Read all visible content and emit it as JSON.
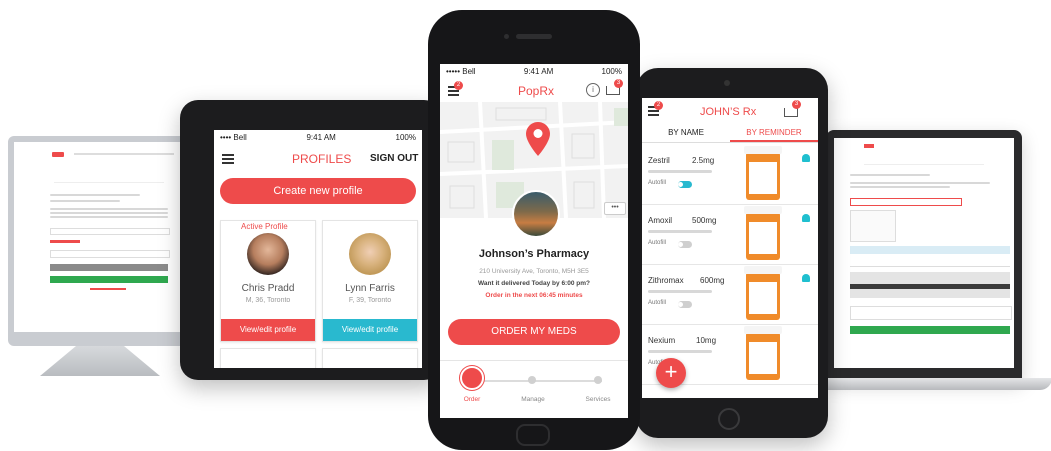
{
  "profiles_app": {
    "status": {
      "carrier": "•••• Bell",
      "time": "9:41 AM",
      "battery": "100%"
    },
    "title": "PROFILES",
    "sign_out": "SIGN OUT",
    "create_button": "Create new profile",
    "active_label": "Active Profile",
    "profiles": [
      {
        "name": "Chris Pradd",
        "details": "M, 36, Toronto",
        "button": "View/edit profile"
      },
      {
        "name": "Lynn Farris",
        "details": "F, 39, Toronto",
        "button": "View/edit profile"
      }
    ]
  },
  "main_app": {
    "status": {
      "carrier": "••••• Bell",
      "time": "9:41 AM",
      "battery": "100%"
    },
    "title": "PopRx",
    "menu_badge": "2",
    "cart_badge": "3",
    "more_label": "•••",
    "pharmacy_name": "Johnson’s Pharmacy",
    "address": "210 University Ave, Toronto, M5H 3E5",
    "delivery_question": "Want it delivered Today by 6:00 pm?",
    "order_countdown": "Order in the next 06:45 minutes",
    "order_button": "ORDER MY MEDS",
    "steps": [
      "Order",
      "Manage",
      "Services"
    ]
  },
  "rx_app": {
    "menu_badge": "2",
    "cart_badge": "3",
    "title": "JOHN’S Rx",
    "tabs": [
      "BY NAME",
      "BY REMINDER"
    ],
    "autofill_label": "Autofill",
    "meds": [
      {
        "name": "Zestril",
        "dose": "2.5mg",
        "autofill": true
      },
      {
        "name": "Amoxil",
        "dose": "500mg",
        "autofill": false
      },
      {
        "name": "Zithromax",
        "dose": "600mg",
        "autofill": false
      },
      {
        "name": "Nexium",
        "dose": "10mg",
        "autofill": false
      }
    ],
    "fab": "+"
  },
  "colors": {
    "accent": "#ee4b4b",
    "teal": "#29b9cf",
    "dark": "#1c1c1e"
  }
}
